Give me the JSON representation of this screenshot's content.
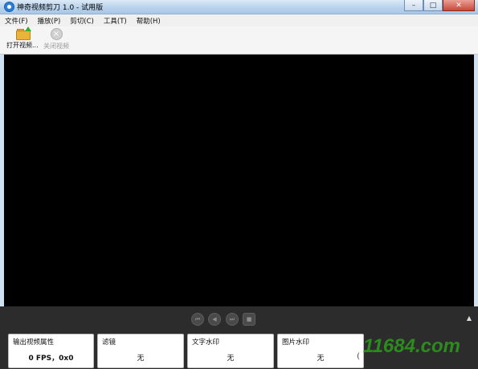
{
  "window": {
    "title": "神奇视频剪刀 1.0 - 试用版",
    "controls": [
      "–",
      "□",
      "✕"
    ]
  },
  "menu": [
    "文件(F)",
    "播放(P)",
    "剪切(C)",
    "工具(T)",
    "帮助(H)"
  ],
  "toolbar": {
    "open_label": "打开视频...",
    "close_label": "关闭视频"
  },
  "transport": {
    "scroll_glyph": "▲",
    "buttons": [
      "⏮",
      "◀",
      "⏭",
      "■"
    ]
  },
  "panels": [
    {
      "title": "输出视频属性",
      "value": "0 FPS，0x0"
    },
    {
      "title": "滤镜",
      "value": "无"
    },
    {
      "title": "文字水印",
      "value": "无"
    },
    {
      "title": "图片水印",
      "value": "无",
      "extra": "("
    }
  ],
  "watermark": "11684.com",
  "colors": {
    "title_bar": "#b9d2ec",
    "video_bg": "#000000",
    "bottom_panel": "#2c2c2c",
    "watermark": "#2d8a1f"
  }
}
